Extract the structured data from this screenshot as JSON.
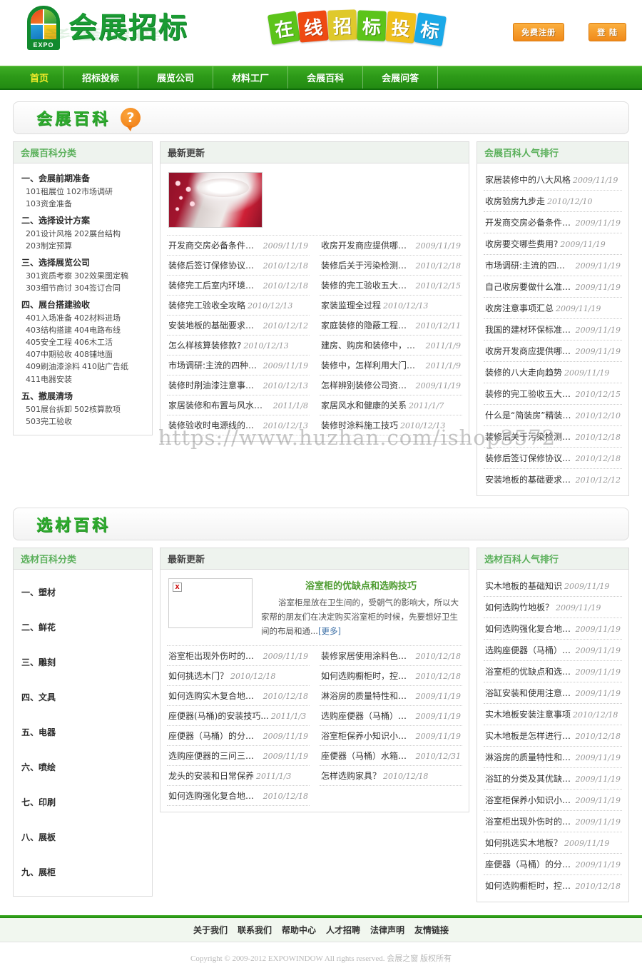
{
  "header": {
    "logo_text": "会展招标",
    "logo_badge": "EXPO",
    "banner_tiles": [
      {
        "char": "在",
        "color": "#5cc41a"
      },
      {
        "char": "线",
        "color": "#ef4a12"
      },
      {
        "char": "招",
        "color": "#dfc92c"
      },
      {
        "char": "标",
        "color": "#5cc41a"
      },
      {
        "char": "投",
        "color": "#f0c01c"
      },
      {
        "char": "标",
        "color": "#1ba9e8"
      }
    ],
    "register_label": "免费注册",
    "login_label": "登 陆"
  },
  "nav": {
    "items": [
      {
        "label": "首页",
        "active": true
      },
      {
        "label": "招标投标",
        "active": false
      },
      {
        "label": "展览公司",
        "active": false
      },
      {
        "label": "材料工厂",
        "active": false
      },
      {
        "label": "会展百科",
        "active": false
      },
      {
        "label": "会展问答",
        "active": false
      }
    ]
  },
  "watermark": "https://www.huzhan.com/ishop3572",
  "section1": {
    "title": "会展百科",
    "help_icon": "?",
    "categories_head": "会展百科分类",
    "latest_head": "最新更新",
    "ranking_head": "会展百科人气排行",
    "categories": [
      {
        "title": "一、会展前期准备",
        "subs": [
          "101租展位",
          "102市场调研",
          "103资金准备"
        ]
      },
      {
        "title": "二、选择设计方案",
        "subs": [
          "201设计风格",
          "202展台结构",
          "203制定预算"
        ]
      },
      {
        "title": "三、选择展览公司",
        "subs": [
          "301资质考察",
          "302效果图定稿",
          "303细节商讨",
          "304签订合同"
        ]
      },
      {
        "title": "四、展台搭建验收",
        "subs": [
          "401入场准备",
          "402材料进场",
          "403结构搭建",
          "404电路布线",
          "405安全工程",
          "406木工活",
          "407中期验收",
          "408铺地面",
          "409刷油漆涂料",
          "410贴广告纸",
          "411电器安装"
        ]
      },
      {
        "title": "五、撤展清场",
        "subs": [
          "501展台拆卸",
          "502核算款项",
          "503完工验收"
        ]
      }
    ],
    "feature": {
      "thumb_alt": "室内装修效果图"
    },
    "news": [
      {
        "title": "开发商交房必备条件有哪些？",
        "date": "2009/11/19"
      },
      {
        "title": "收房开发商应提供哪些文件?",
        "date": "2009/11/19"
      },
      {
        "title": "装修后签订保修协议注意事项",
        "date": "2010/12/18"
      },
      {
        "title": "装修后关于污染检测的标准...",
        "date": "2010/12/18"
      },
      {
        "title": "装修完工后室内环境污染的...",
        "date": "2010/12/18"
      },
      {
        "title": "装修的完工验收五大注意事项",
        "date": "2010/12/15"
      },
      {
        "title": "装修完工验收全攻略",
        "date": "2010/12/13"
      },
      {
        "title": "家装监理全过程",
        "date": "2010/12/13"
      },
      {
        "title": "安装地板的基础要求和注意...",
        "date": "2010/12/12"
      },
      {
        "title": "家庭装修的隐蔽工程六要素",
        "date": "2010/12/11"
      },
      {
        "title": "怎么样核算装修款?",
        "date": "2010/12/13"
      },
      {
        "title": "建房、购房和装修中，要注...",
        "date": "2011/1/9"
      },
      {
        "title": "市场调研:主流的四种装修...",
        "date": "2009/11/19"
      },
      {
        "title": "装修中，怎样利用大门的颜...",
        "date": "2011/1/9"
      },
      {
        "title": "装修时刷油漆注意事项 把...",
        "date": "2010/12/13"
      },
      {
        "title": "怎样辨别装修公司资质？",
        "date": "2009/11/19"
      },
      {
        "title": "家居装修和布置与风水的关系",
        "date": "2011/1/8"
      },
      {
        "title": "家居风水和健康的关系",
        "date": "2011/1/7"
      },
      {
        "title": "装修验收时电源线的验收...",
        "date": "2010/12/13"
      },
      {
        "title": "装修时涂料施工技巧",
        "date": "2010/12/13"
      }
    ],
    "ranking": [
      {
        "title": "家居装修中的八大风格",
        "date": "2009/11/19"
      },
      {
        "title": "收房验房九步走",
        "date": "2010/12/10"
      },
      {
        "title": "开发商交房必备条件有哪些？",
        "date": "2009/11/19"
      },
      {
        "title": "收房要交哪些费用?",
        "date": "2009/11/19"
      },
      {
        "title": "市场调研:主流的四种装修...",
        "date": "2009/11/19"
      },
      {
        "title": "自己收房要做什么准备，要...",
        "date": "2009/11/19"
      },
      {
        "title": "收房注意事项汇总",
        "date": "2009/11/19"
      },
      {
        "title": "我国的建材环保标准有哪些？",
        "date": "2009/11/19"
      },
      {
        "title": "收房开发商应提供哪些文件?",
        "date": "2009/11/19"
      },
      {
        "title": "装修的八大走向趋势",
        "date": "2009/11/19"
      },
      {
        "title": "装修的完工验收五大注意事项",
        "date": "2010/12/15"
      },
      {
        "title": "什么是“简装房”精装修...",
        "date": "2010/12/10"
      },
      {
        "title": "装修后关于污染检测的标准...",
        "date": "2010/12/18"
      },
      {
        "title": "装修后签订保修协议注意事项",
        "date": "2010/12/18"
      },
      {
        "title": "安装地板的基础要求和注意...",
        "date": "2010/12/12"
      }
    ]
  },
  "section2": {
    "title": "选材百科",
    "categories_head": "选材百科分类",
    "latest_head": "最新更新",
    "ranking_head": "选材百科人气排行",
    "categories": [
      {
        "title": "一、塑材"
      },
      {
        "title": "二、鲜花"
      },
      {
        "title": "三、雕刻"
      },
      {
        "title": "四、文具"
      },
      {
        "title": "五、电器"
      },
      {
        "title": "六、喷绘"
      },
      {
        "title": "七、印刷"
      },
      {
        "title": "八、展板"
      },
      {
        "title": "九、展柜"
      }
    ],
    "feature": {
      "title": "浴室柜的优缺点和选购技巧",
      "desc": "浴室柜是放在卫生间的，受朝气的影响大，所以大家帮的朋友们在决定购买浴室柜的时候，先要想好卫生间的布局和通...",
      "more": "[更多]",
      "broken_image": "x"
    },
    "news": [
      {
        "title": "浴室柜出现外伤时的处理方法",
        "date": "2009/11/19"
      },
      {
        "title": "装修家居使用涂料色彩四原则",
        "date": "2010/12/18"
      },
      {
        "title": "如何挑选木门？",
        "date": "2010/12/18"
      },
      {
        "title": "如何选购橱柜时，控制质量...",
        "date": "2010/12/18"
      },
      {
        "title": "如何选购实木复合地板？",
        "date": "2010/12/18"
      },
      {
        "title": "淋浴房的质量特性和选购技巧",
        "date": "2009/11/19"
      },
      {
        "title": "座便器(马桶)的安装技巧...",
        "date": "2011/1/3"
      },
      {
        "title": "选购座便器（马桶）的技巧",
        "date": "2009/11/19"
      },
      {
        "title": "座便器（马桶）的分类和它...",
        "date": "2009/11/19"
      },
      {
        "title": "浴室柜保养小知识小技巧",
        "date": "2009/11/19"
      },
      {
        "title": "选购座便器的三问三答（购...",
        "date": "2009/11/19"
      },
      {
        "title": "座便器（马桶）水箱配件常...",
        "date": "2010/12/31"
      },
      {
        "title": "龙头的安装和日常保养",
        "date": "2011/1/3"
      },
      {
        "title": "怎样选购家具？",
        "date": "2010/12/18"
      },
      {
        "title": "如何选购强化复合地板？",
        "date": "2010/12/18"
      }
    ],
    "ranking": [
      {
        "title": "实木地板的基础知识",
        "date": "2009/11/19"
      },
      {
        "title": "如何选购竹地板？",
        "date": "2009/11/19"
      },
      {
        "title": "如何选购强化复合地板？",
        "date": "2009/11/19"
      },
      {
        "title": "选购座便器（马桶）的技巧",
        "date": "2009/11/19"
      },
      {
        "title": "浴室柜的优缺点和选购技巧",
        "date": "2009/11/19"
      },
      {
        "title": "浴缸安装和使用注意事项",
        "date": "2009/11/19"
      },
      {
        "title": "实木地板安装注意事项",
        "date": "2010/12/18"
      },
      {
        "title": "实木地板是怎样进行保养的？",
        "date": "2010/12/18"
      },
      {
        "title": "淋浴房的质量特性和选购技巧",
        "date": "2009/11/19"
      },
      {
        "title": "浴缸的分类及其优缺点和如...",
        "date": "2009/11/19"
      },
      {
        "title": "浴室柜保养小知识小技巧",
        "date": "2009/11/19"
      },
      {
        "title": "浴室柜出现外伤时的处理方法",
        "date": "2009/11/19"
      },
      {
        "title": "如何挑选实木地板？",
        "date": "2009/11/19"
      },
      {
        "title": "座便器（马桶）的分类和它...",
        "date": "2009/11/19"
      },
      {
        "title": "如何选购橱柜时，控制质量...",
        "date": "2010/12/18"
      }
    ]
  },
  "footer": {
    "links": [
      "关于我们",
      "联系我们",
      "帮助中心",
      "人才招聘",
      "法律声明",
      "友情链接"
    ],
    "copyright": "Copyright © 2009-2012 EXPOWINDOW All rights reserved. 会展之窗 版权所有"
  }
}
